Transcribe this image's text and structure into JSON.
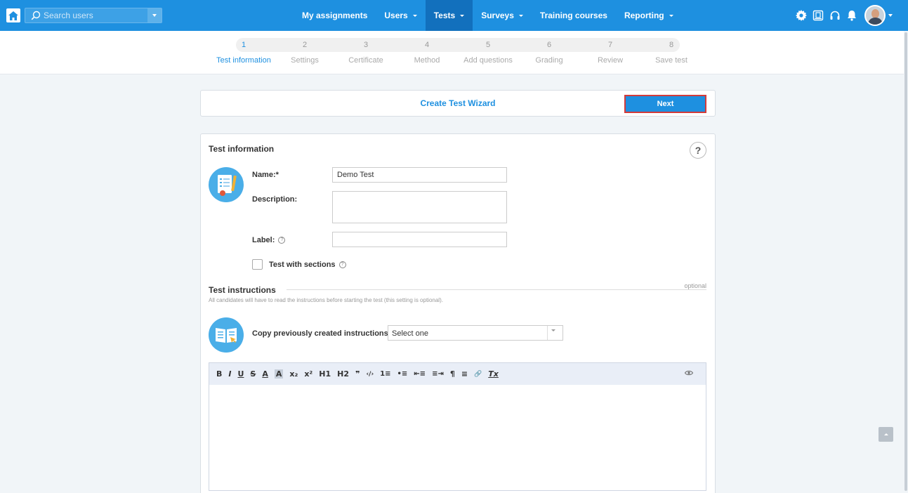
{
  "nav": {
    "search_placeholder": "Search users",
    "items": [
      {
        "label": "My assignments",
        "dropdown": false,
        "active": false
      },
      {
        "label": "Users",
        "dropdown": true,
        "active": false
      },
      {
        "label": "Tests",
        "dropdown": true,
        "active": true
      },
      {
        "label": "Surveys",
        "dropdown": true,
        "active": false
      },
      {
        "label": "Training courses",
        "dropdown": false,
        "active": false
      },
      {
        "label": "Reporting",
        "dropdown": true,
        "active": false
      }
    ],
    "right_icons": [
      "gear-icon",
      "book-icon",
      "headset-icon",
      "bell-icon"
    ],
    "accent_color": "#1e90e0",
    "active_color": "#1270bd"
  },
  "stepper": {
    "current": 1,
    "steps": [
      {
        "num": "1",
        "label": "Test information"
      },
      {
        "num": "2",
        "label": "Settings"
      },
      {
        "num": "3",
        "label": "Certificate"
      },
      {
        "num": "4",
        "label": "Method"
      },
      {
        "num": "5",
        "label": "Add questions"
      },
      {
        "num": "6",
        "label": "Grading"
      },
      {
        "num": "7",
        "label": "Review"
      },
      {
        "num": "8",
        "label": "Save test"
      }
    ]
  },
  "wizard": {
    "title": "Create Test Wizard",
    "next_label": "Next"
  },
  "test_info": {
    "title": "Test information",
    "help": "?",
    "name_label": "Name:*",
    "name_value": "Demo Test",
    "description_label": "Description:",
    "description_value": "",
    "label_label": "Label:",
    "label_value": "",
    "sections_label": "Test with sections",
    "sections_checked": false
  },
  "instructions": {
    "title": "Test instructions",
    "optional": "optional",
    "note": "All candidates will have to read the instructions before starting the test (this setting is optional).",
    "copy_label": "Copy previously created instructions:",
    "copy_selected": "Select one"
  },
  "editor": {
    "toolbar": [
      "B",
      "I",
      "U",
      "S",
      "A",
      "A",
      "x₂",
      "x²",
      "H1",
      "H2",
      "❞",
      "‹/›",
      "1≡",
      "•≡",
      "⇤≡",
      "≡⇥",
      "¶",
      "≡",
      "🔗",
      "Tx"
    ],
    "toolbar_names": [
      "bold",
      "italic",
      "underline",
      "strike",
      "font-color",
      "background-color",
      "subscript",
      "superscript",
      "heading-1",
      "heading-2",
      "blockquote",
      "code",
      "ordered-list",
      "bullet-list",
      "outdent",
      "indent",
      "text-direction",
      "align",
      "link",
      "clear-format"
    ],
    "preview_icon": "eye-icon"
  }
}
